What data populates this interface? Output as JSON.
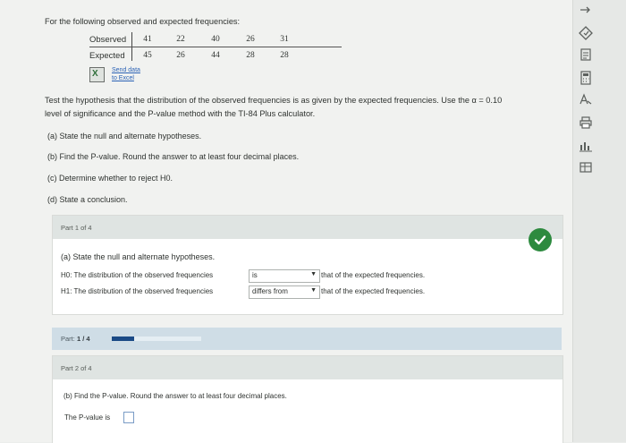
{
  "question": {
    "intro": "For the following observed and expected frequencies:",
    "table": {
      "observed_label": "Observed",
      "expected_label": "Expected",
      "observed": [
        "41",
        "22",
        "40",
        "26",
        "31"
      ],
      "expected": [
        "45",
        "26",
        "44",
        "28",
        "28"
      ]
    },
    "send_data_line1": "Send data",
    "send_data_line2": "to Excel",
    "paragraph_line1": "Test the hypothesis that the distribution of the observed frequencies is as given by the expected frequencies. Use the α = 0.10",
    "paragraph_line2": "level of significance and the P-value method with the TI-84 Plus calculator.",
    "items": [
      "(a) State the null and alternate hypotheses.",
      "(b) Find the P-value. Round the answer to at least four decimal places.",
      "(c) Determine whether to reject H0.",
      "(d) State a conclusion."
    ]
  },
  "part1": {
    "header": "Part 1 of 4",
    "prompt": "(a) State the null and alternate hypotheses.",
    "h0_label": "H0: The distribution of the observed frequencies",
    "h0_select": "is",
    "h0_suffix": "that of the expected frequencies.",
    "h1_label": "H1: The distribution of the observed frequencies",
    "h1_select": "differs from",
    "h1_suffix": "that of the expected frequencies.",
    "status_icon": "checkmark-icon",
    "status_color": "#2d8a3f"
  },
  "progress": {
    "label": "Part:",
    "value": "1 / 4",
    "fraction": 0.25,
    "color": "#1b4a86"
  },
  "part2": {
    "header": "Part 2 of 4",
    "prompt": "(b) Find the P-value. Round the answer to at least four decimal places.",
    "pvalue_label": "The P-value is",
    "pvalue_value": ""
  },
  "sidebar": {
    "icons": [
      "collapse-arrow-icon",
      "diamond-icon",
      "notes-icon",
      "calculator-icon",
      "text-size-icon",
      "print-icon",
      "data-icon",
      "table-icon"
    ]
  }
}
